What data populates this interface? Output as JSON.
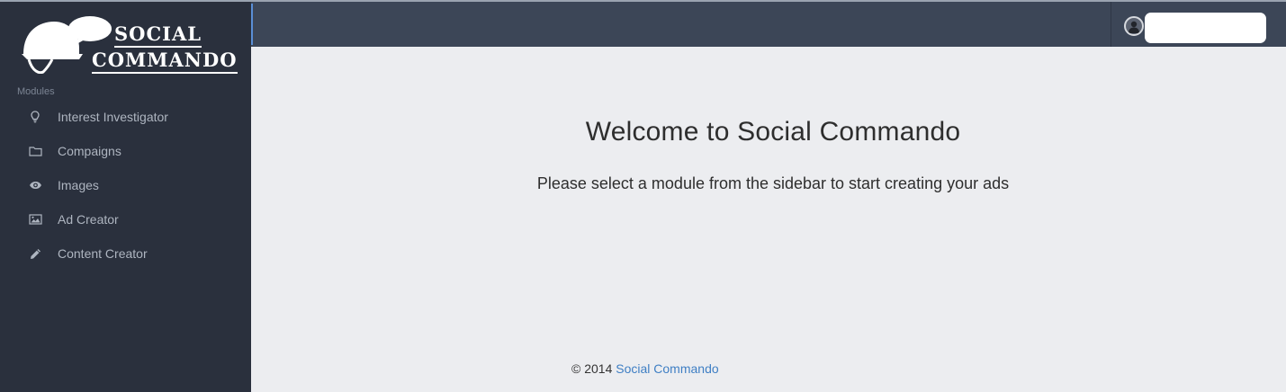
{
  "brand": {
    "name_line1": "SOCIAL",
    "name_line2": "COMMANDO"
  },
  "sidebar": {
    "section_heading": "Modules",
    "items": [
      {
        "label": "Interest Investigator",
        "icon": "lightbulb-icon"
      },
      {
        "label": "Compaigns",
        "icon": "folder-icon"
      },
      {
        "label": "Images",
        "icon": "eye-icon"
      },
      {
        "label": "Ad Creator",
        "icon": "picture-icon"
      },
      {
        "label": "Content Creator",
        "icon": "pencil-icon"
      }
    ]
  },
  "topbar": {
    "user_name": ""
  },
  "main": {
    "title": "Welcome to Social Commando",
    "subtitle": "Please select a module from the sidebar to start creating your ads"
  },
  "footer": {
    "copyright": "© 2014",
    "link_text": "Social Commando"
  },
  "colors": {
    "sidebar_bg": "#2a303d",
    "topbar_bg": "#3c4657",
    "content_bg": "#ecedf0",
    "link": "#3f7fc4"
  }
}
